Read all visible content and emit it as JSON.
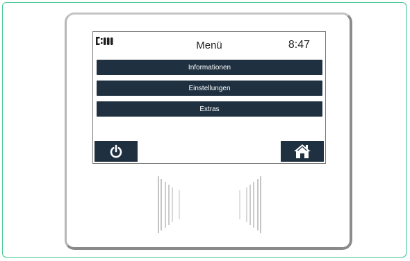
{
  "header": {
    "title": "Menü",
    "time": "8:47",
    "signal_icon": "signal-bars-icon"
  },
  "menu": {
    "items": [
      {
        "label": "Informationen"
      },
      {
        "label": "Einstellungen"
      },
      {
        "label": "Extras"
      }
    ]
  },
  "footer": {
    "power_icon": "power-icon",
    "home_icon": "home-icon"
  },
  "colors": {
    "button_bg": "#1f3041",
    "button_text": "#ffffff",
    "frame_border": "#3cc48e",
    "device_bezel": "#9a9a9a"
  }
}
